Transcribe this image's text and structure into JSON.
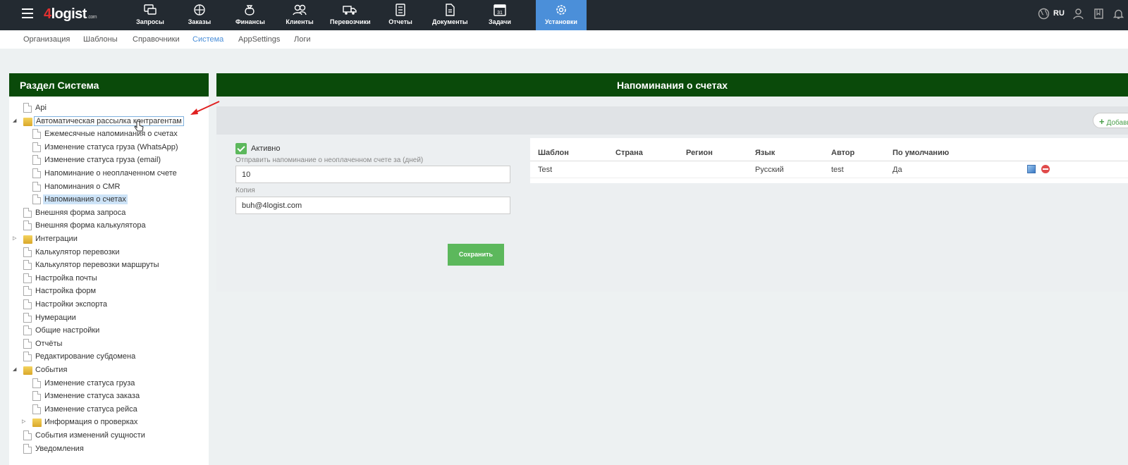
{
  "logo": {
    "four": "4",
    "rest": "logist",
    "suffix": ".com"
  },
  "topnav": [
    {
      "label": "Запросы",
      "icon": "requests-icon"
    },
    {
      "label": "Заказы",
      "icon": "orders-icon"
    },
    {
      "label": "Финансы",
      "icon": "finance-icon"
    },
    {
      "label": "Клиенты",
      "icon": "clients-icon"
    },
    {
      "label": "Перевозчики",
      "icon": "carriers-icon"
    },
    {
      "label": "Отчеты",
      "icon": "reports-icon"
    },
    {
      "label": "Документы",
      "icon": "documents-icon"
    },
    {
      "label": "Задачи",
      "icon": "tasks-icon"
    },
    {
      "label": "Установки",
      "icon": "settings-icon",
      "active": true
    }
  ],
  "lang": "RU",
  "subnav": [
    "Организация",
    "Шаблоны",
    "Справочники",
    "Система",
    "AppSettings",
    "Логи"
  ],
  "subnav_active": "Система",
  "left_panel": {
    "title": "Раздел Система",
    "tree": [
      {
        "label": "Api",
        "level": 0,
        "type": "doc"
      },
      {
        "label": "Автоматическая рассылка контрагентам",
        "level": 0,
        "type": "folder",
        "expanded": true,
        "focused": true
      },
      {
        "label": "Ежемесячные напоминания о счетах",
        "level": 1,
        "type": "doc"
      },
      {
        "label": "Изменение статуса груза (WhatsApp)",
        "level": 1,
        "type": "doc"
      },
      {
        "label": "Изменение статуса груза (email)",
        "level": 1,
        "type": "doc"
      },
      {
        "label": "Напоминание о неоплаченном счете",
        "level": 1,
        "type": "doc"
      },
      {
        "label": "Напоминания о CMR",
        "level": 1,
        "type": "doc"
      },
      {
        "label": "Напоминания о счетах",
        "level": 1,
        "type": "doc",
        "selected": true
      },
      {
        "label": "Внешняя форма запроса",
        "level": 0,
        "type": "doc"
      },
      {
        "label": "Внешняя форма калькулятора",
        "level": 0,
        "type": "doc"
      },
      {
        "label": "Интеграции",
        "level": 0,
        "type": "folder",
        "expanded": false
      },
      {
        "label": "Калькулятор перевозки",
        "level": 0,
        "type": "doc"
      },
      {
        "label": "Калькулятор перевозки маршруты",
        "level": 0,
        "type": "doc"
      },
      {
        "label": "Настройка почты",
        "level": 0,
        "type": "doc"
      },
      {
        "label": "Настройка форм",
        "level": 0,
        "type": "doc"
      },
      {
        "label": "Настройки экспорта",
        "level": 0,
        "type": "doc"
      },
      {
        "label": "Нумерации",
        "level": 0,
        "type": "doc"
      },
      {
        "label": "Общие настройки",
        "level": 0,
        "type": "doc"
      },
      {
        "label": "Отчёты",
        "level": 0,
        "type": "doc"
      },
      {
        "label": "Редактирование субдомена",
        "level": 0,
        "type": "doc"
      },
      {
        "label": "События",
        "level": 0,
        "type": "folder",
        "expanded": true
      },
      {
        "label": "Изменение статуса груза",
        "level": 1,
        "type": "doc"
      },
      {
        "label": "Изменение статуса заказа",
        "level": 1,
        "type": "doc"
      },
      {
        "label": "Изменение статуса рейса",
        "level": 1,
        "type": "doc"
      },
      {
        "label": "Информация о проверках",
        "level": 1,
        "type": "folder",
        "expanded": false
      },
      {
        "label": "События изменений сущности",
        "level": 0,
        "type": "doc"
      },
      {
        "label": "Уведомления",
        "level": 0,
        "type": "doc"
      }
    ]
  },
  "right_panel": {
    "title": "Напоминания о счетах",
    "add_label": "Добавить",
    "active_label": "Активно",
    "days_label": "Отправить напоминание о неоплаченном счете за (дней)",
    "days_value": "10",
    "copy_label": "Копия",
    "copy_value": "buh@4logist.com",
    "save_label": "Сохранить",
    "table": {
      "headers": [
        "Шаблон",
        "Страна",
        "Регион",
        "Язык",
        "Автор",
        "По умолчанию"
      ],
      "rows": [
        [
          "Test",
          "",
          "",
          "Русский",
          "test",
          "Да"
        ]
      ]
    }
  },
  "colors": {
    "topbar": "#232a31",
    "active_nav": "#4b8fd9",
    "panel_header": "#0a4a0a",
    "save": "#5cb85c"
  }
}
